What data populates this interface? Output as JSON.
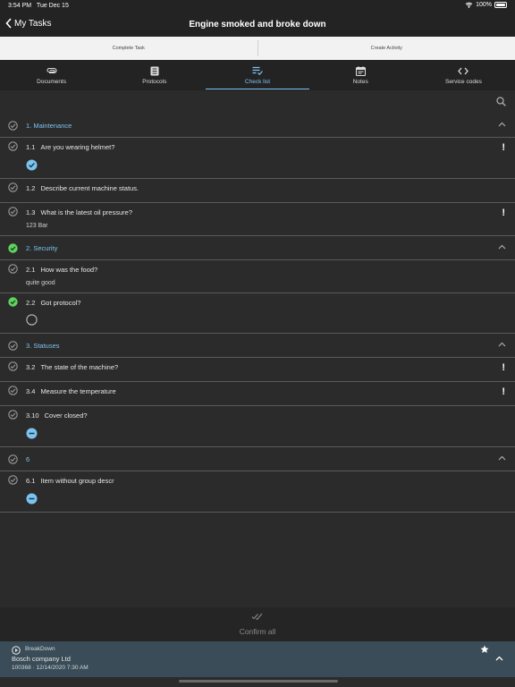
{
  "status_bar": {
    "time": "3:54 PM",
    "date": "Tue Dec 15",
    "battery": "100%",
    "icons": [
      "wifi-icon",
      "battery-icon"
    ]
  },
  "nav": {
    "back_label": "My Tasks",
    "title": "Engine smoked and broke down"
  },
  "actions": {
    "complete_task": "Complete Task",
    "create_activity": "Create Activity"
  },
  "tabs": [
    {
      "label": "Documents",
      "icon": "paperclip-icon"
    },
    {
      "label": "Protocols",
      "icon": "document-icon"
    },
    {
      "label": "Check list",
      "icon": "checklist-icon",
      "active": true
    },
    {
      "label": "Notes",
      "icon": "calendar-icon"
    },
    {
      "label": "Service codes",
      "icon": "code-icon"
    }
  ],
  "groups": [
    {
      "title": "1. Maintenance",
      "done": false,
      "items": [
        {
          "num": "1.1",
          "text": "Are you wearing helmet?",
          "mandatory": true,
          "answer_icon": "checked-circle-icon"
        },
        {
          "num": "1.2",
          "text": "Describe current machine status.",
          "mandatory": false
        },
        {
          "num": "1.3",
          "text": "What is the latest oil pressure?",
          "mandatory": true,
          "answer": "123  Bar"
        }
      ]
    },
    {
      "title": "2. Security",
      "done": true,
      "items": [
        {
          "num": "2.1",
          "text": "How was the food?",
          "mandatory": false,
          "answer": "quite good"
        },
        {
          "num": "2.2",
          "text": "Got protocol?",
          "mandatory": false,
          "done": true,
          "answer_icon": "empty-circle-icon"
        }
      ]
    },
    {
      "title": "3. Statuses",
      "done": false,
      "items": [
        {
          "num": "3.2",
          "text": "The state of the machine?",
          "mandatory": true
        },
        {
          "num": "3.4",
          "text": "Measure the temperature",
          "mandatory": true
        },
        {
          "num": "3.10",
          "text": "Cover closed?",
          "mandatory": false,
          "answer_icon": "minus-circle-icon"
        }
      ]
    },
    {
      "title": "6",
      "done": false,
      "items": [
        {
          "num": "6.1",
          "text": "Item without group descr",
          "mandatory": false,
          "answer_icon": "minus-circle-icon"
        }
      ]
    }
  ],
  "mandatory_mark": "!",
  "confirm": {
    "label": "Confirm all",
    "icon": "double-check-icon"
  },
  "footer": {
    "type": "BreakDown",
    "company": "Bosch company Ltd",
    "meta": "100368  ·  12/14/2020  7:30 AM"
  },
  "colors": {
    "accent": "#7cc3f0",
    "done": "#5fd35f",
    "background": "#2b2b2b",
    "footer": "#3a4c57"
  }
}
